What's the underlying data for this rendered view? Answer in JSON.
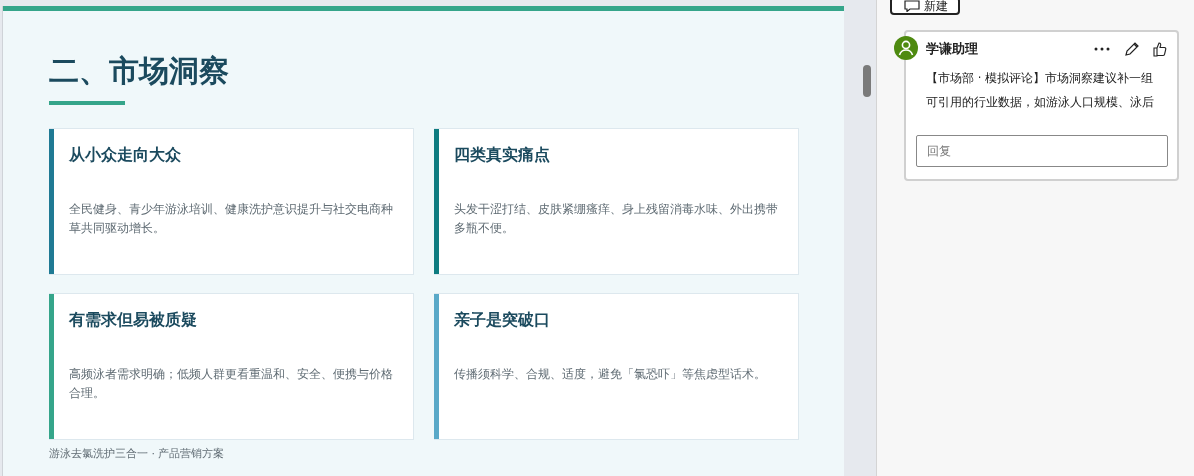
{
  "slide": {
    "title": "二、市场洞察",
    "cards": [
      {
        "title": "从小众走向大众",
        "text": "全民健身、青少年游泳培训、健康洗护意识提升与社交电商种草共同驱动增长。",
        "color": "#1f7a94"
      },
      {
        "title": "四类真实痛点",
        "text": "头发干涩打结、皮肤紧绷瘙痒、身上残留消毒水味、外出携带多瓶不便。",
        "color": "#0e7c80"
      },
      {
        "title": "有需求但易被质疑",
        "text": "高频泳者需求明确；低频人群更看重温和、安全、便携与价格合理。",
        "color": "#35a58a"
      },
      {
        "title": "亲子是突破口",
        "text": "传播须科学、合规、适度，避免「氯恐吓」等焦虑型话术。",
        "color": "#5aa9c8"
      }
    ],
    "footer": "游泳去氯洗护三合一 · 产品营销方案"
  },
  "comments_pane": {
    "new_button": "新建",
    "comment": {
      "author": "学谦助理",
      "lines": [
        "【市场部 · 模拟评论】市场洞察建议补一组",
        "可引用的行业数据，如游泳人口规模、泳后"
      ]
    },
    "reply": {
      "placeholder": "回复"
    }
  }
}
